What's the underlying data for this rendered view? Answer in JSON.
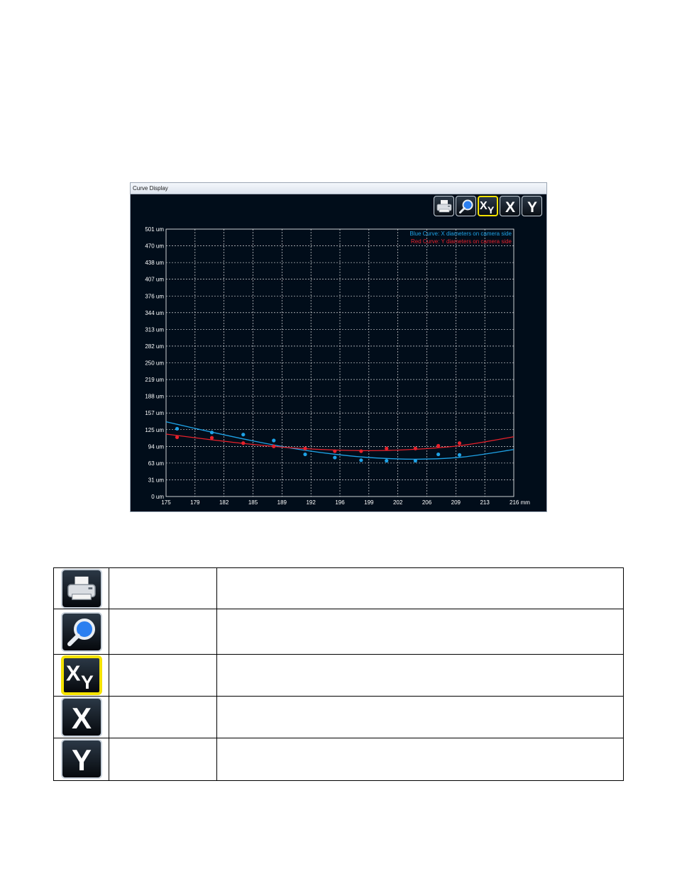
{
  "window": {
    "title": "Curve Display"
  },
  "toolbar": {
    "buttons": [
      {
        "name": "print-button",
        "icon": "printer-icon"
      },
      {
        "name": "zoom-button",
        "icon": "magnifier-icon"
      },
      {
        "name": "xy-button",
        "icon": "xy-icon",
        "label": "XY",
        "active": true
      },
      {
        "name": "x-button",
        "icon": "x-icon",
        "label": "X"
      },
      {
        "name": "y-button",
        "icon": "y-icon",
        "label": "Y"
      }
    ]
  },
  "chart_data": {
    "type": "scatter",
    "background": "#010d1a",
    "grid": true,
    "grid_style": "dashed white",
    "legend_placement": "top-right",
    "x_unit": "mm",
    "y_unit": "um",
    "xlim": [
      175,
      216
    ],
    "ylim": [
      0,
      501
    ],
    "x_ticks": [
      "175",
      "179",
      "182",
      "185",
      "189",
      "192",
      "196",
      "199",
      "202",
      "206",
      "209",
      "213",
      "216 mm"
    ],
    "y_ticks": [
      "0 um",
      "31 um",
      "63 um",
      "94 um",
      "125 um",
      "157 um",
      "188 um",
      "219 um",
      "250 um",
      "282 um",
      "313 um",
      "344 um",
      "376 um",
      "407 um",
      "438 um",
      "470 um",
      "501 um"
    ],
    "series": [
      {
        "name": "Blue Curve: X diameters on camera side",
        "color": "#1ea2e6",
        "points": [
          [
            176.3,
            127
          ],
          [
            180.4,
            120
          ],
          [
            184.1,
            116
          ],
          [
            187.7,
            105
          ],
          [
            191.4,
            79
          ],
          [
            194.9,
            73
          ],
          [
            198.0,
            68
          ],
          [
            201.0,
            67
          ],
          [
            204.4,
            67
          ],
          [
            207.1,
            79
          ],
          [
            209.6,
            78
          ]
        ],
        "fit": [
          [
            175,
            140
          ],
          [
            180,
            122
          ],
          [
            185,
            105
          ],
          [
            190,
            90
          ],
          [
            195,
            79
          ],
          [
            200,
            72
          ],
          [
            205,
            70
          ],
          [
            210,
            74
          ],
          [
            216,
            88
          ]
        ]
      },
      {
        "name": "Red Curve: Y diameters on camera side",
        "color": "#e8212b",
        "points": [
          [
            176.3,
            111
          ],
          [
            180.4,
            110
          ],
          [
            184.1,
            100
          ],
          [
            187.7,
            94
          ],
          [
            191.4,
            90
          ],
          [
            194.9,
            85
          ],
          [
            198.0,
            85
          ],
          [
            201.0,
            90
          ],
          [
            204.4,
            90
          ],
          [
            207.1,
            95
          ],
          [
            209.6,
            100
          ]
        ],
        "fit": [
          [
            175,
            117
          ],
          [
            180,
            107
          ],
          [
            185,
            98
          ],
          [
            190,
            91
          ],
          [
            195,
            87
          ],
          [
            200,
            86
          ],
          [
            205,
            89
          ],
          [
            210,
            96
          ],
          [
            216,
            112
          ]
        ]
      }
    ]
  },
  "legend_rows": [
    {
      "icon": "printer-icon",
      "name": "",
      "description": ""
    },
    {
      "icon": "magnifier-icon",
      "name": "",
      "description": ""
    },
    {
      "icon": "xy-icon",
      "label": "XY",
      "active": true,
      "name": "",
      "description": ""
    },
    {
      "icon": "x-icon",
      "label": "X",
      "name": "",
      "description": ""
    },
    {
      "icon": "y-icon",
      "label": "Y",
      "name": "",
      "description": ""
    }
  ]
}
